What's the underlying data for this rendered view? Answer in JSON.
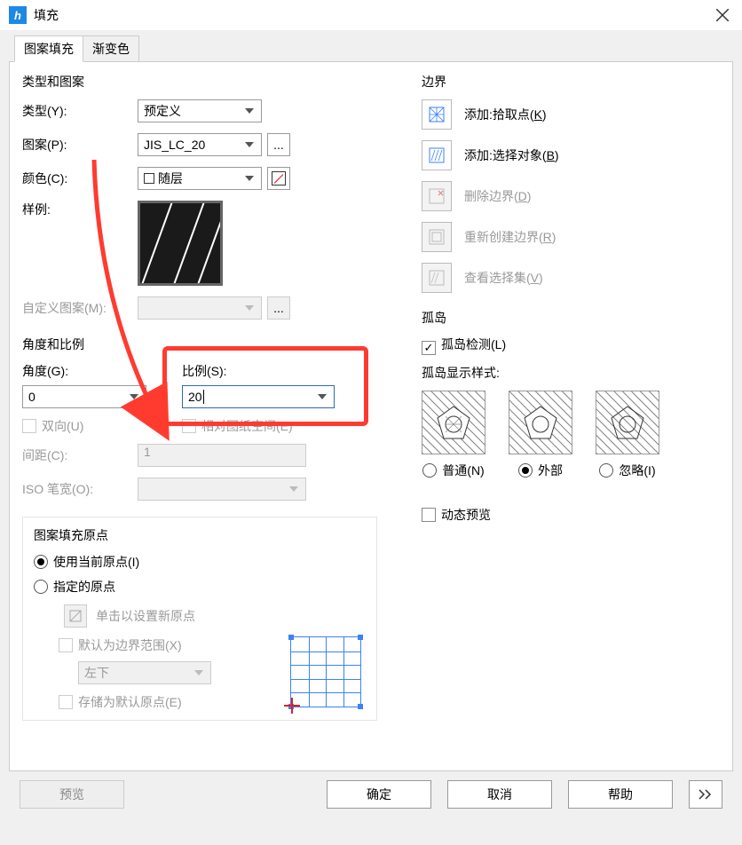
{
  "title": "填充",
  "tabs": {
    "pattern": "图案填充",
    "gradient": "渐变色",
    "active": 0
  },
  "group_type_pattern": {
    "title": "类型和图案",
    "type_label": "类型(Y):",
    "type_value": "预定义",
    "pattern_label": "图案(P):",
    "pattern_value": "JIS_LC_20",
    "color_label": "颜色(C):",
    "color_value": "随层",
    "sample_label": "样例:",
    "custom_label": "自定义图案(M):"
  },
  "group_angle_scale": {
    "title": "角度和比例",
    "angle_label": "角度(G):",
    "angle_value": "0",
    "scale_label": "比例(S):",
    "scale_value": "20",
    "bidir_label": "双向(U)",
    "rel_paper_label": "相对图纸空间(E)",
    "spacing_label": "间距(C):",
    "spacing_value": "1",
    "iso_pen_label": "ISO 笔宽(O):"
  },
  "group_origin": {
    "title": "图案填充原点",
    "use_current": "使用当前原点(I)",
    "specified": "指定的原点",
    "click_set": "单击以设置新原点",
    "default_ext": "默认为边界范围(X)",
    "corner_value": "左下",
    "store_default": "存储为默认原点(E)"
  },
  "boundary": {
    "title": "边界",
    "add_pick": {
      "pre": "添加:拾取点(",
      "key": "K",
      "post": ")"
    },
    "add_select": {
      "pre": "添加:选择对象(",
      "key": "B",
      "post": ")"
    },
    "delete": {
      "pre": "删除边界(",
      "key": "D",
      "post": ")"
    },
    "recreate": {
      "pre": "重新创建边界(",
      "key": "R",
      "post": ")"
    },
    "view_sel": {
      "pre": "查看选择集(",
      "key": "V",
      "post": ")"
    }
  },
  "islands": {
    "title": "孤岛",
    "detect": "孤岛检测(L)",
    "style_label": "孤岛显示样式:",
    "normal": "普通(N)",
    "outer": "外部",
    "ignore": "忽略(I)"
  },
  "dynamic_preview": "动态预览",
  "footer": {
    "preview": "预览",
    "ok": "确定",
    "cancel": "取消",
    "help": "帮助"
  }
}
